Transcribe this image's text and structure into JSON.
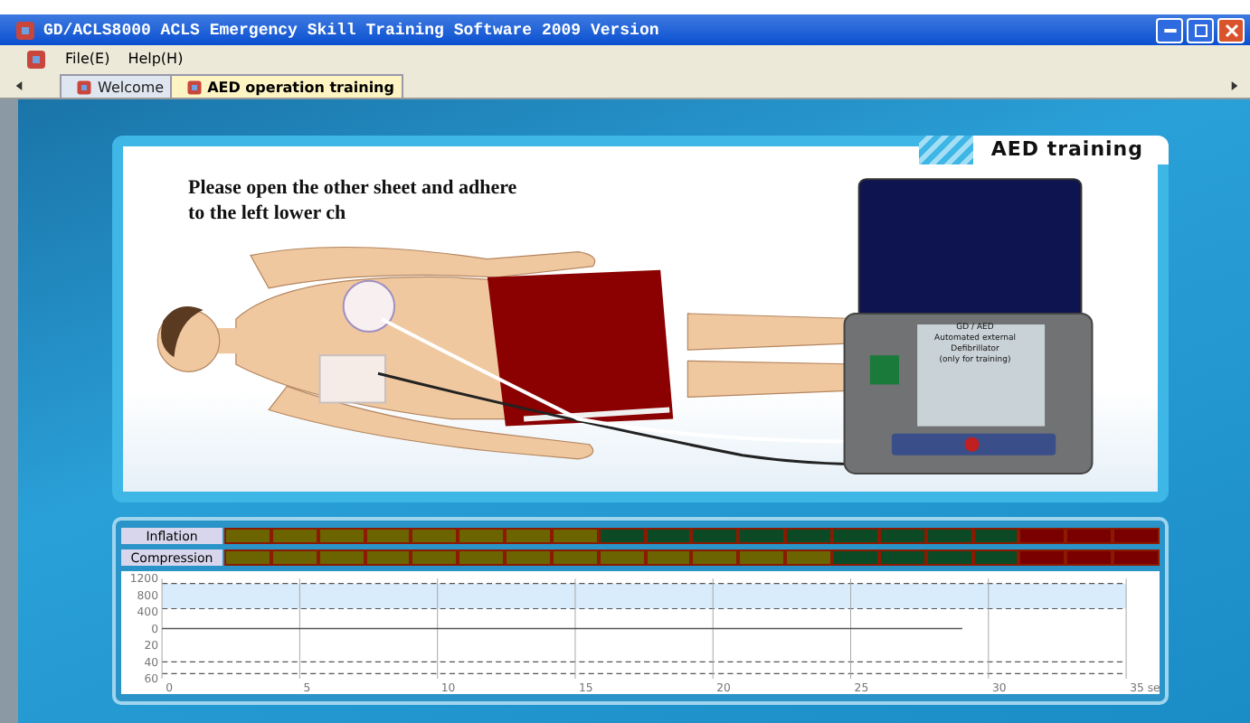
{
  "window": {
    "title": "GD/ACLS8000 ACLS Emergency Skill Training Software 2009 Version"
  },
  "menu": [
    "File(E)",
    "Help(H)"
  ],
  "tabs": [
    {
      "label": "Welcome",
      "selected": false
    },
    {
      "label": "AED operation training",
      "selected": true
    }
  ],
  "scene": {
    "heading": "AED training",
    "instruction": "Please open the other sheet and adhere to the left lower ch",
    "aed_label": [
      "GD / AED",
      "Automated external",
      "Defibrillator",
      "(only for training)"
    ]
  },
  "meters": [
    {
      "label": "Inflation",
      "segments": [
        {
          "color": "#6b6400"
        },
        {
          "color": "#6b6400"
        },
        {
          "color": "#6b6400"
        },
        {
          "color": "#6b6400"
        },
        {
          "color": "#6b6400"
        },
        {
          "color": "#6b6400"
        },
        {
          "color": "#6b6400"
        },
        {
          "color": "#6b6400"
        },
        {
          "color": "#0b4a24"
        },
        {
          "color": "#0b4a24"
        },
        {
          "color": "#0b4a24"
        },
        {
          "color": "#0b4a24"
        },
        {
          "color": "#0b4a24"
        },
        {
          "color": "#0b4a24"
        },
        {
          "color": "#0b4a24"
        },
        {
          "color": "#0b4a24"
        },
        {
          "color": "#0b4a24"
        },
        {
          "color": "#7a0000"
        },
        {
          "color": "#7a0000"
        },
        {
          "color": "#7a0000"
        }
      ]
    },
    {
      "label": "Compression",
      "segments": [
        {
          "color": "#6b6400"
        },
        {
          "color": "#6b6400"
        },
        {
          "color": "#6b6400"
        },
        {
          "color": "#6b6400"
        },
        {
          "color": "#6b6400"
        },
        {
          "color": "#6b6400"
        },
        {
          "color": "#6b6400"
        },
        {
          "color": "#6b6400"
        },
        {
          "color": "#6b6400"
        },
        {
          "color": "#6b6400"
        },
        {
          "color": "#6b6400"
        },
        {
          "color": "#6b6400"
        },
        {
          "color": "#6b6400"
        },
        {
          "color": "#0b4a24"
        },
        {
          "color": "#0b4a24"
        },
        {
          "color": "#0b4a24"
        },
        {
          "color": "#0b4a24"
        },
        {
          "color": "#7a0000"
        },
        {
          "color": "#7a0000"
        },
        {
          "color": "#7a0000"
        }
      ]
    }
  ],
  "chart": {
    "x_labels": [
      "0",
      "5",
      "10",
      "15",
      "20",
      "25",
      "30",
      "35 se"
    ],
    "y_labels": [
      "1200",
      "800",
      "400",
      "0",
      "20",
      "40",
      "60"
    ]
  }
}
